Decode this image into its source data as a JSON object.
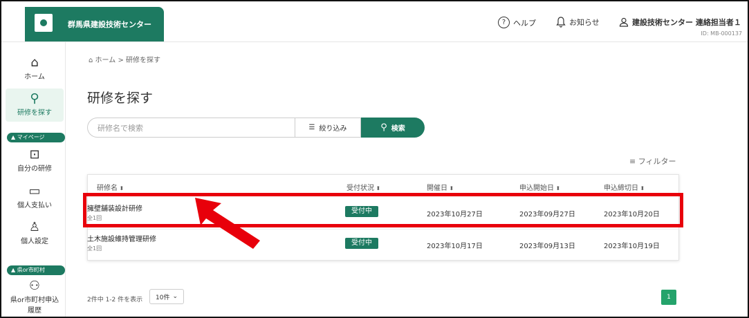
{
  "header": {
    "title": "群馬県建設技術センター",
    "help": "ヘルプ",
    "notices": "お知らせ",
    "user": "建設技術センター 連絡担当者１",
    "user_id": "ID: MB-000137"
  },
  "sidebar": {
    "home": "ホーム",
    "search": "研修を探す",
    "mypage": "マイページ",
    "my_training": "自分の研修",
    "personal_payment": "個人支払い",
    "personal_settings": "個人設定",
    "pref_section": "県or市町村",
    "pref_history": "県or市町村申込",
    "pref_history2": "履歴"
  },
  "breadcrumb": {
    "home": "ホーム",
    "sep": ">",
    "current": "研修を探す"
  },
  "page_title": "研修を探す",
  "search": {
    "placeholder": "研修名で検索",
    "filter_label": "絞り込み",
    "search_label": "検索"
  },
  "filter_link": "フィルター",
  "table": {
    "columns": [
      "研修名",
      "受付状況",
      "開催日",
      "申込開始日",
      "申込締切日"
    ],
    "rows": [
      {
        "name": "擁壁舗装設計研修",
        "sub": "全1回",
        "status": "受付中",
        "date": "2023年10月27日",
        "start": "2023年09月27日",
        "deadline": "2023年10月20日"
      },
      {
        "name": "土木施設維持管理研修",
        "sub": "全1回",
        "status": "受付中",
        "date": "2023年10月17日",
        "start": "2023年09月13日",
        "deadline": "2023年10月19日"
      }
    ]
  },
  "pager": {
    "summary": "2件中 1-2 件を表示",
    "per_page": "10件",
    "current_page": "1"
  },
  "colors": {
    "brand": "#1d7a61",
    "highlight": "#e8000b"
  }
}
